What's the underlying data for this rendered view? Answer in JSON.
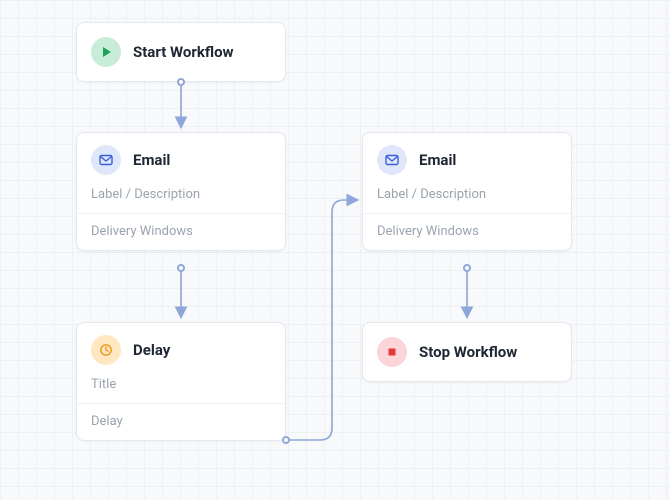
{
  "nodes": {
    "start": {
      "title": "Start Workflow"
    },
    "email1": {
      "title": "Email",
      "rows": [
        "Label / Description",
        "Delivery Windows"
      ]
    },
    "delay": {
      "title": "Delay",
      "rows": [
        "Title",
        "Delay"
      ]
    },
    "email2": {
      "title": "Email",
      "rows": [
        "Label / Description",
        "Delivery Windows"
      ]
    },
    "stop": {
      "title": "Stop Workflow"
    }
  },
  "colors": {
    "connector": "#8ea6d9"
  }
}
